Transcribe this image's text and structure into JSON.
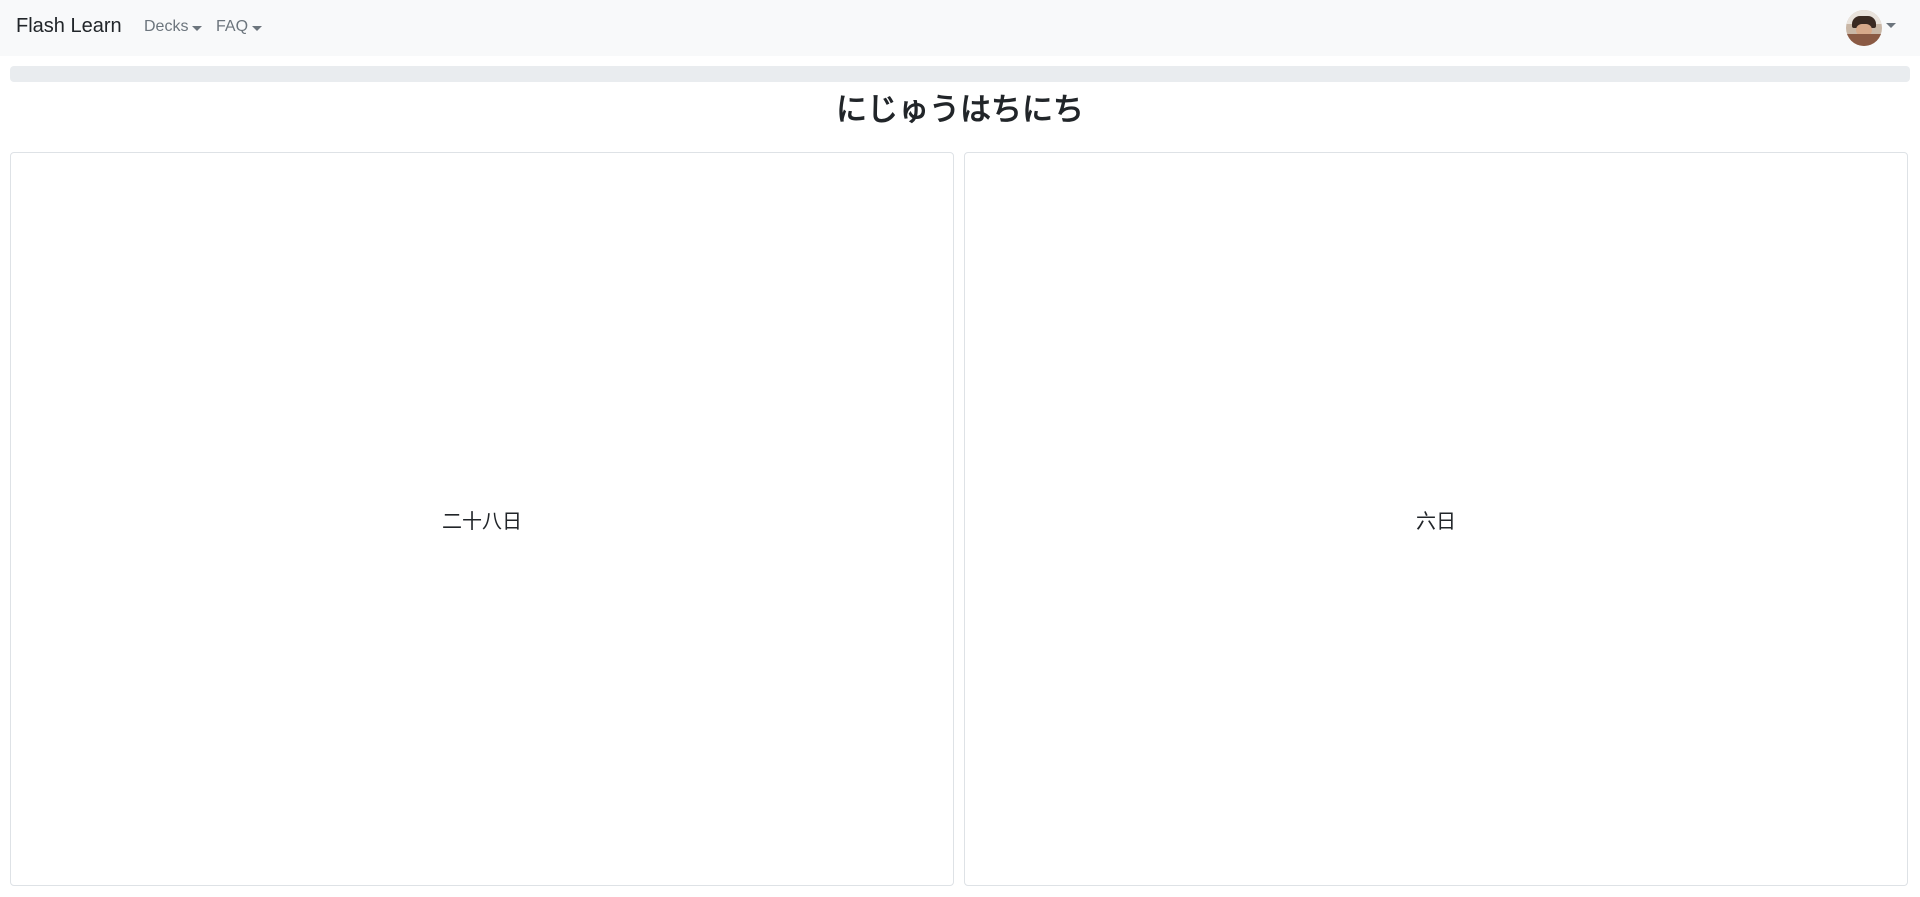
{
  "navbar": {
    "brand": "Flash Learn",
    "menus": [
      {
        "label": "Decks",
        "icon": "chevron-down-icon"
      },
      {
        "label": "FAQ",
        "icon": "chevron-down-icon"
      }
    ],
    "user_menu": {
      "icon": "avatar"
    }
  },
  "progress": {
    "value_fraction": 0.0
  },
  "card": {
    "title": "にじゅうはちにち",
    "choices": [
      {
        "label": "二十八日"
      },
      {
        "label": "六日"
      }
    ]
  },
  "colors": {
    "navbar_bg": "#f8f9fa",
    "progress_track": "#e9ecef",
    "card_border": "#dee2e6"
  }
}
